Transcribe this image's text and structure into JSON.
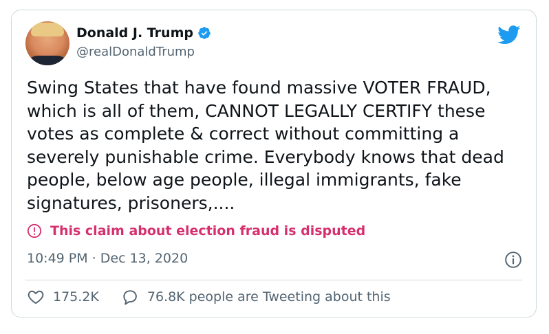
{
  "author": {
    "display_name": "Donald J. Trump",
    "handle": "@realDonaldTrump",
    "verified": true
  },
  "tweet": {
    "text": "Swing States that have found massive VOTER FRAUD, which is all of them, CANNOT LEGALLY CERTIFY these votes as complete & correct without committing a severely punishable crime. Everybody knows that dead people, below age people, illegal immigrants, fake signatures, prisoners,....",
    "timestamp": "10:49 PM · Dec 13, 2020"
  },
  "notice": {
    "text": "This claim about election fraud is disputed",
    "color": "#d62f6d"
  },
  "engagement": {
    "likes": "175.2K",
    "conversation": "76.8K people are Tweeting about this"
  },
  "icons": {
    "brand": "twitter-bird-icon",
    "verified": "verified-badge-icon",
    "notice": "exclamation-circle-icon",
    "info": "info-icon",
    "like": "heart-icon",
    "reply": "speech-bubble-icon"
  },
  "colors": {
    "brand": "#1d9bf0",
    "secondary_text": "#536471",
    "border": "#cfd9de"
  }
}
